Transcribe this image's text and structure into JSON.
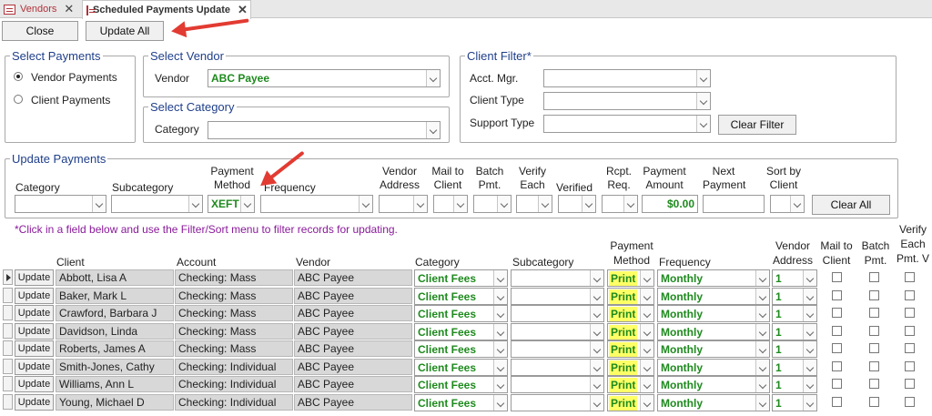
{
  "tabs": [
    {
      "label": "Vendors"
    },
    {
      "label": "Scheduled Payments Update"
    }
  ],
  "toolbar": {
    "close_label": "Close",
    "update_all_label": "Update All"
  },
  "select_payments": {
    "title": "Select Payments",
    "options": [
      "Vendor Payments",
      "Client Payments"
    ],
    "selected": "Vendor Payments"
  },
  "select_vendor": {
    "title": "Select Vendor",
    "label": "Vendor",
    "value": "ABC Payee"
  },
  "select_category": {
    "title": "Select Category",
    "label": "Category",
    "value": ""
  },
  "client_filter": {
    "title": "Client Filter*",
    "acct_mgr_label": "Acct. Mgr.",
    "client_type_label": "Client Type",
    "support_type_label": "Support Type",
    "clear_filter_label": "Clear Filter"
  },
  "update_payments": {
    "title": "Update Payments",
    "category_label": "Category",
    "subcategory_label": "Subcategory",
    "payment_method_label": "Payment Method",
    "payment_method_value": "XEFT",
    "frequency_label": "Frequency",
    "vendor_address_label": "Vendor Address",
    "mail_to_client_label": "Mail to Client",
    "batch_pmt_label": "Batch Pmt.",
    "verify_each_label": "Verify Each",
    "verified_label": "Verified",
    "rcpt_req_label": "Rcpt. Req.",
    "payment_amount_label": "Payment Amount",
    "payment_amount_value": "$0.00",
    "next_payment_label": "Next Payment",
    "sort_by_client_label": "Sort by Client",
    "clear_all_label": "Clear All"
  },
  "note": "*Click in a field below and use the Filter/Sort menu to filter records for updating.",
  "table": {
    "headers": {
      "client": "Client",
      "account": "Account",
      "vendor": "Vendor",
      "category": "Category",
      "subcategory": "Subcategory",
      "payment_method": "Payment Method",
      "frequency": "Frequency",
      "vendor_address": "Vendor Address",
      "mail_to_client": "Mail to Client",
      "batch_pmt": "Batch Pmt.",
      "verify_each": "Verify Each Pmt. V"
    },
    "update_label": "Update",
    "rows": [
      {
        "client": "Abbott, Lisa A",
        "account": "Checking: Mass",
        "vendor": "ABC Payee",
        "category": "Client Fees",
        "subcategory": "",
        "payment_method": "Print",
        "frequency": "Monthly",
        "vendor_address": "1"
      },
      {
        "client": "Baker, Mark L",
        "account": "Checking: Mass",
        "vendor": "ABC Payee",
        "category": "Client Fees",
        "subcategory": "",
        "payment_method": "Print",
        "frequency": "Monthly",
        "vendor_address": "1"
      },
      {
        "client": "Crawford, Barbara J",
        "account": "Checking: Mass",
        "vendor": "ABC Payee",
        "category": "Client Fees",
        "subcategory": "",
        "payment_method": "Print",
        "frequency": "Monthly",
        "vendor_address": "1"
      },
      {
        "client": "Davidson, Linda",
        "account": "Checking: Mass",
        "vendor": "ABC Payee",
        "category": "Client Fees",
        "subcategory": "",
        "payment_method": "Print",
        "frequency": "Monthly",
        "vendor_address": "1"
      },
      {
        "client": "Roberts, James A",
        "account": "Checking: Mass",
        "vendor": "ABC Payee",
        "category": "Client Fees",
        "subcategory": "",
        "payment_method": "Print",
        "frequency": "Monthly",
        "vendor_address": "1"
      },
      {
        "client": "Smith-Jones, Cathy",
        "account": "Checking: Individual",
        "vendor": "ABC Payee",
        "category": "Client Fees",
        "subcategory": "",
        "payment_method": "Print",
        "frequency": "Monthly",
        "vendor_address": "1"
      },
      {
        "client": "Williams, Ann L",
        "account": "Checking: Individual",
        "vendor": "ABC Payee",
        "category": "Client Fees",
        "subcategory": "",
        "payment_method": "Print",
        "frequency": "Monthly",
        "vendor_address": "1"
      },
      {
        "client": "Young, Michael D",
        "account": "Checking: Individual",
        "vendor": "ABC Payee",
        "category": "Client Fees",
        "subcategory": "",
        "payment_method": "Print",
        "frequency": "Monthly",
        "vendor_address": "1"
      }
    ]
  },
  "colors": {
    "accent": "#1f3f8a",
    "value_green": "#1e8a1e",
    "highlight": "#ffff66",
    "annotation_red": "#e23b32",
    "note_purple": "#8a1a9a"
  }
}
